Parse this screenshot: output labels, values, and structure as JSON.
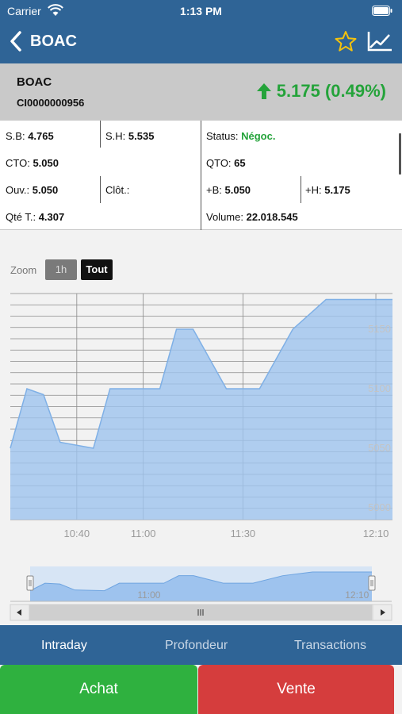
{
  "status_bar": {
    "carrier": "Carrier",
    "time": "1:13 PM"
  },
  "nav": {
    "title": "BOAC",
    "icons": [
      "back-chevron-icon",
      "star-icon",
      "trend-chart-icon"
    ]
  },
  "quote": {
    "name": "BOAC",
    "isin": "CI0000000956",
    "change": "5.175 (0.49%)",
    "direction": "up",
    "color": "#24a33a"
  },
  "info": {
    "sb_label": "S.B:",
    "sb_value": "4.765",
    "sh_label": "S.H:",
    "sh_value": "5.535",
    "status_label": "Status:",
    "status_value": "Négoc.",
    "cto_label": "CTO:",
    "cto_value": "5.050",
    "qto_label": "QTO:",
    "qto_value": "65",
    "ouv_label": "Ouv.:",
    "ouv_value": "5.050",
    "clot_label": "Clôt.:",
    "clot_value": "",
    "b_label": "+B:",
    "b_value": "5.050",
    "h_label": "+H:",
    "h_value": "5.175",
    "qte_label": "Qté T.:",
    "qte_value": "4.307",
    "volume_label": "Volume:",
    "volume_value": "22.018.545"
  },
  "zoom": {
    "label": "Zoom",
    "options": [
      "1h",
      "Tout"
    ],
    "selected": "Tout"
  },
  "chart_data": {
    "type": "area",
    "x_ticks": [
      "10:40",
      "11:00",
      "11:30",
      "12:10"
    ],
    "y_ticks": [
      "5000",
      "5050",
      "5100",
      "5150"
    ],
    "x_range": [
      "10:20",
      "12:15"
    ],
    "ylim": [
      4990,
      5180
    ],
    "points": [
      {
        "x": "10:20",
        "y": 5050
      },
      {
        "x": "10:25",
        "y": 5100
      },
      {
        "x": "10:30",
        "y": 5095
      },
      {
        "x": "10:35",
        "y": 5055
      },
      {
        "x": "10:45",
        "y": 5050
      },
      {
        "x": "10:50",
        "y": 5100
      },
      {
        "x": "11:05",
        "y": 5100
      },
      {
        "x": "11:10",
        "y": 5150
      },
      {
        "x": "11:15",
        "y": 5150
      },
      {
        "x": "11:25",
        "y": 5100
      },
      {
        "x": "11:35",
        "y": 5100
      },
      {
        "x": "11:45",
        "y": 5150
      },
      {
        "x": "11:55",
        "y": 5175
      },
      {
        "x": "12:15",
        "y": 5175
      }
    ],
    "navigator_x_ticks": [
      "11:00",
      "12:10"
    ],
    "fill_color": "#9ec3ee",
    "line_color": "#7fb0e6",
    "grid": true
  },
  "tabs": [
    {
      "label": "Intraday",
      "active": true
    },
    {
      "label": "Profondeur",
      "active": false
    },
    {
      "label": "Transactions",
      "active": false
    }
  ],
  "actions": {
    "buy": "Achat",
    "sell": "Vente",
    "buy_color": "#2fb13f",
    "sell_color": "#d53d3d"
  }
}
